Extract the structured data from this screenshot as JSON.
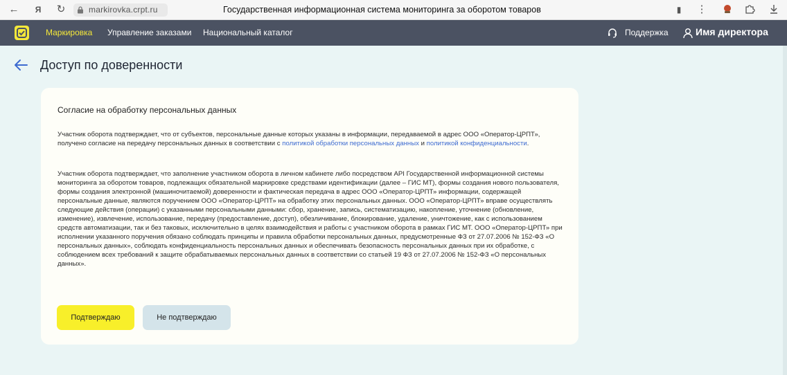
{
  "browser": {
    "url": "markirovka.crpt.ru",
    "page_title": "Государственная информационная система мониторинга за оборотом товаров"
  },
  "nav": {
    "items": [
      "Маркировка",
      "Управление заказами",
      "Национальный каталог"
    ],
    "support_label": "Поддержка",
    "user_label": "Имя директора"
  },
  "page": {
    "heading": "Доступ по доверенности"
  },
  "consent": {
    "title": "Согласие на обработку персональных данных",
    "paragraph1": {
      "text_before": "Участник оборота подтверждает, что от субъектов, персональные данные которых указаны в информации, передаваемой в адрес ООО «Оператор-ЦРПТ», получено согласие на передачу персональных данных в соответствии с ",
      "link1": "политикой обработки персональных данных",
      "text_middle": " и ",
      "link2": "политикой конфиденциальности",
      "text_after": "."
    },
    "paragraph2": "Участник оборота подтверждает, что заполнение участником оборота в личном кабинете либо посредством API Государственной информационной системы мониторинга за оборотом товаров, подлежащих обязательной маркировке средствами идентификации (далее – ГИС МТ), формы создания нового пользователя, формы создания электронной (машиночитаемой) доверенности и фактическая передача в адрес ООО «Оператор-ЦРПТ» информации, содержащей персональные данные, являются поручением ООО «Оператор-ЦРПТ» на обработку этих персональных данных. ООО «Оператор-ЦРПТ» вправе осуществлять следующие действия (операции) с указанными персональными данными: сбор, хранение, запись, систематизацию, накопление, уточнение (обновление, изменение), извлечение, использование, передачу (предоставление, доступ), обезличивание, блокирование, удаление, уничтожение, как с использованием средств автоматизации, так и без таковых, исключительно в целях взаимодействия и работы с участником оборота в рамках ГИС МТ. ООО «Оператор-ЦРПТ» при исполнении указанного поручения обязано соблюдать принципы и правила обработки персональных данных, предусмотренные ФЗ от 27.07.2006 № 152-ФЗ «О персональных данных», соблюдать конфиденциальность персональных данных и обеспечивать безопасность персональных данных при их обработке, с соблюдением всех требований к защите обрабатываемых персональных данных в соответствии со статьей 19 ФЗ от 27.07.2006 № 152-ФЗ «О персональных данных».",
    "confirm_label": "Подтверждаю",
    "decline_label": "Не подтверждаю"
  },
  "colors": {
    "nav_bg": "#4b5262",
    "accent_yellow": "#f8ef2a",
    "page_bg": "#eaf5f5",
    "link": "#3c6ad0",
    "secondary_button": "#d4e4ea"
  }
}
